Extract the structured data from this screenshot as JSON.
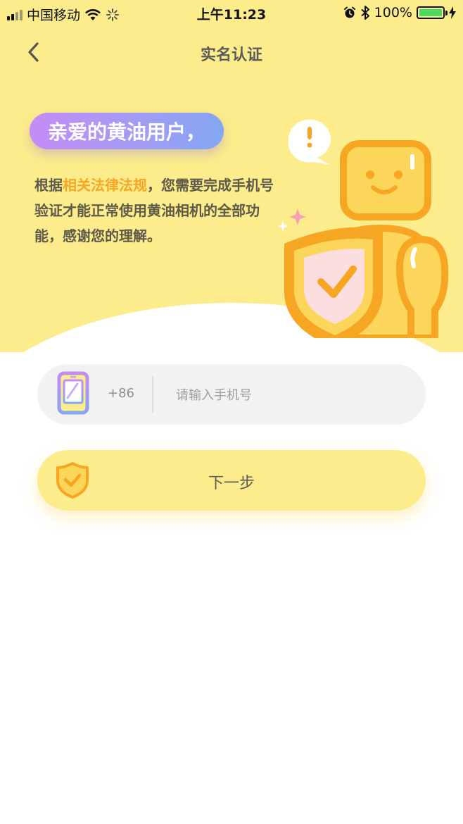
{
  "status_bar": {
    "carrier": "中国移动",
    "time": "上午11:23",
    "battery_percent": "100%",
    "battery_level": 1.0
  },
  "header": {
    "title": "实名认证",
    "back_icon": "chevron-left-icon"
  },
  "hero": {
    "greeting": "亲爱的黄油用户，",
    "intro_prefix": "根据",
    "intro_highlight": "相关法律法规",
    "intro_suffix": "，您需要完成手机号验证才能正常使用黄油相机的全部功能，感谢您的理解。"
  },
  "form": {
    "country_code": "+86",
    "phone_placeholder": "请输入手机号",
    "phone_value": "",
    "next_label": "下一步"
  },
  "colors": {
    "hero_bg": "#fcec8b",
    "accent_orange": "#f6a623",
    "pill_gradient_start": "#c58cf6",
    "pill_gradient_end": "#84a6f2",
    "battery_green": "#4cd964"
  }
}
